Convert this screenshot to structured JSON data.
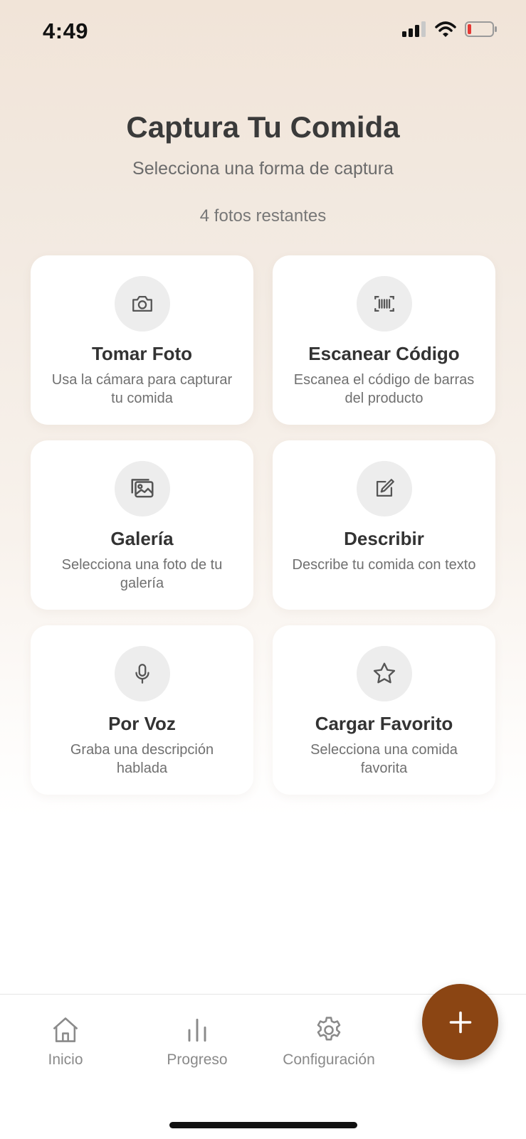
{
  "status_bar": {
    "time": "4:49",
    "battery_color": "#e53935"
  },
  "header": {
    "title": "Captura Tu Comida",
    "subtitle": "Selecciona una forma de captura",
    "remaining": "4 fotos restantes"
  },
  "options": [
    {
      "title": "Tomar Foto",
      "description": "Usa la cámara para capturar tu comida",
      "icon": "camera-icon"
    },
    {
      "title": "Escanear Código",
      "description": "Escanea el código de barras del producto",
      "icon": "barcode-icon"
    },
    {
      "title": "Galería",
      "description": "Selecciona una foto de tu galería",
      "icon": "image-icon"
    },
    {
      "title": "Describir",
      "description": "Describe tu comida con texto",
      "icon": "edit-icon"
    },
    {
      "title": "Por Voz",
      "description": "Graba una descripción hablada",
      "icon": "microphone-icon"
    },
    {
      "title": "Cargar Favorito",
      "description": "Selecciona una comida favorita",
      "icon": "star-icon"
    }
  ],
  "tabbar": {
    "items": [
      {
        "label": "Inicio",
        "icon": "home-icon"
      },
      {
        "label": "Progreso",
        "icon": "bar-chart-icon"
      },
      {
        "label": "Configuración",
        "icon": "gear-icon"
      }
    ],
    "fab_icon": "plus-icon",
    "fab_color": "#8b4513"
  }
}
